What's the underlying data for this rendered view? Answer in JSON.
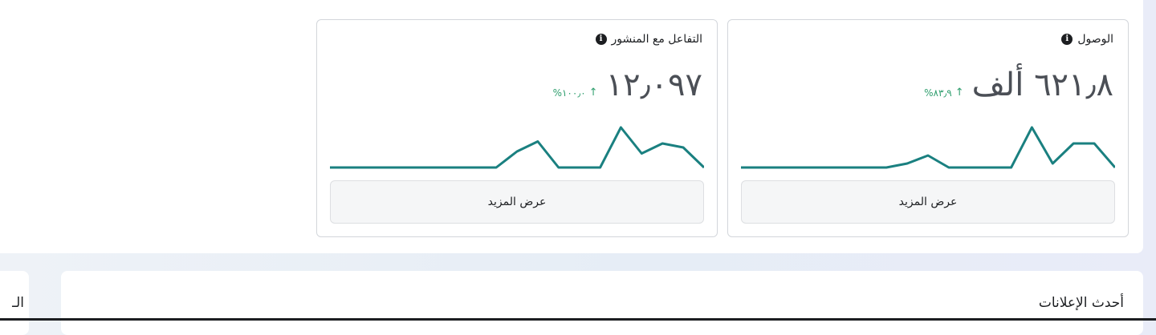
{
  "cards": [
    {
      "id": "reach",
      "title": "الوصول",
      "value": "٦٢١٫٨ ألف",
      "change": "٨٣٫٩%",
      "see_more": "عرض المزيد",
      "sparkline": [
        0,
        0,
        0,
        0,
        0,
        0,
        0,
        0,
        0.1,
        0.3,
        0,
        0,
        0,
        0,
        1,
        0.1,
        0.6,
        0.6,
        0
      ]
    },
    {
      "id": "engagement",
      "title": "التفاعل مع المنشور",
      "value": "١٢٫٠٩٧",
      "change": "١٠٠٫٠%",
      "see_more": "عرض المزيد",
      "sparkline": [
        0,
        0,
        0,
        0,
        0,
        0,
        0,
        0,
        0,
        0.4,
        0.65,
        0,
        0,
        0,
        1,
        0.35,
        0.6,
        0.5,
        0
      ]
    }
  ],
  "latest_ads": {
    "title": "أحدث الإعلانات"
  },
  "left_panel": {
    "title": "الـ"
  },
  "colors": {
    "line": "#1a8080",
    "positive": "#2f9e6e"
  }
}
